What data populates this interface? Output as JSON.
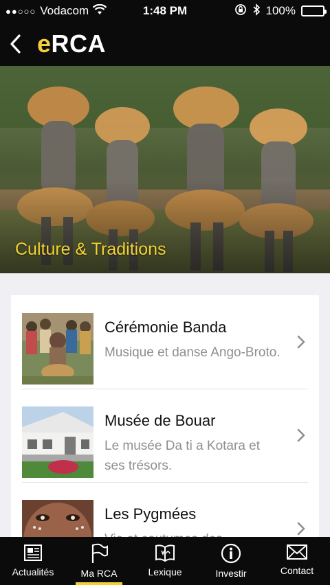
{
  "status_bar": {
    "carrier": "Vodacom",
    "signal_dots": "●●○○○",
    "time": "1:48 PM",
    "battery": "100%",
    "battery_level": 1.0
  },
  "nav": {
    "title_accent": "e",
    "title_rest": "RCA"
  },
  "hero": {
    "caption": "Culture & Traditions"
  },
  "list": [
    {
      "title": "Cérémonie Banda",
      "subtitle": "Musique et danse Ango-Broto."
    },
    {
      "title": "Musée de Bouar",
      "subtitle": "Le musée Da ti a Kotara et ses trésors."
    },
    {
      "title": "Les Pygmées",
      "subtitle": "Vie et coutumes des"
    }
  ],
  "tabs": [
    {
      "label": "Actualités",
      "icon": "newspaper-icon",
      "active": false
    },
    {
      "label": "Ma RCA",
      "icon": "flag-icon",
      "active": true
    },
    {
      "label": "Lexique",
      "icon": "book-icon",
      "active": false
    },
    {
      "label": "Investir",
      "icon": "info-icon",
      "active": false
    },
    {
      "label": "Contact",
      "icon": "envelope-icon",
      "active": false
    }
  ],
  "colors": {
    "accent": "#f5cf3a",
    "bar_background": "#0b0b0b",
    "list_background": "#efeff4"
  }
}
